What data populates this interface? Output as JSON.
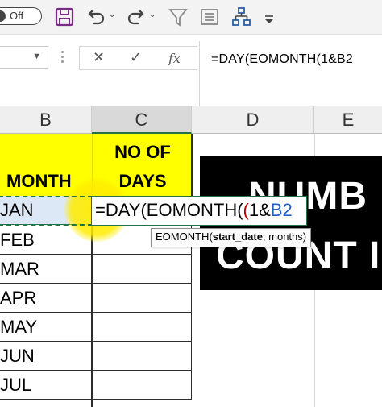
{
  "toolbar": {
    "autosave_label": "Off",
    "icons": [
      "save-icon",
      "undo-icon",
      "redo-icon",
      "filter-icon",
      "form-icon",
      "hierarchy-icon",
      "customize-icon"
    ]
  },
  "formula_bar": {
    "cancel_glyph": "✕",
    "enter_glyph": "✓",
    "fx_label": "fx",
    "formula": "=DAY(EOMONTH(1&B2"
  },
  "columns": [
    "B",
    "C",
    "D",
    "E"
  ],
  "header": {
    "month_label": "MONTH",
    "days_line1": "NO OF",
    "days_line2": "DAYS"
  },
  "rows": [
    "JAN",
    "FEB",
    "MAR",
    "APR",
    "MAY",
    "JUN",
    "JUL"
  ],
  "edit_cell": {
    "part1": "=DAY(EOMONTH(",
    "part2": "1&",
    "part3": "B2"
  },
  "tooltip": {
    "func": "EOMONTH(",
    "arg1": "start_date",
    "rest": ", months)"
  },
  "banner": {
    "line1": "NUMB",
    "line2": "COUNT I"
  },
  "colors": {
    "highlight": "#ffff00",
    "accent_green": "#217346",
    "ref_blue": "#1f5fbf",
    "paren_red": "#c00000"
  }
}
